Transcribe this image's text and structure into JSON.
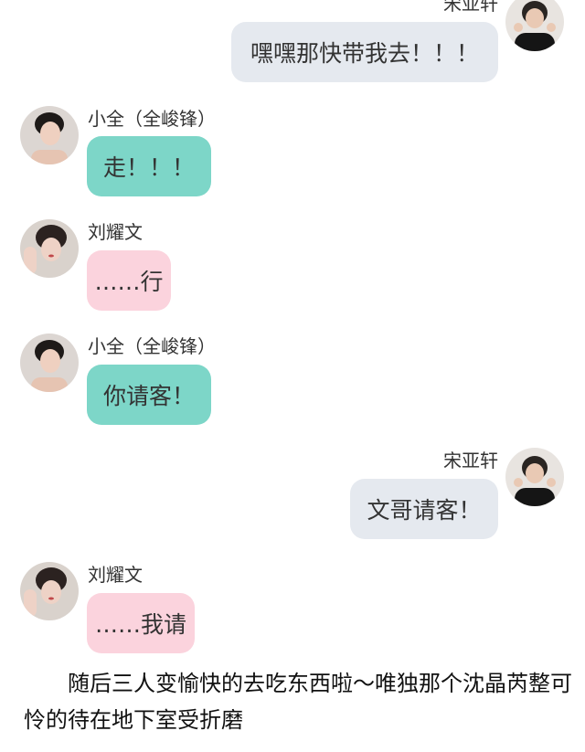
{
  "colors": {
    "bubble_self": "#e5e9ef",
    "bubble_xiaoquan": "#7dd6c8",
    "bubble_liuyaowen": "#fbd3dd"
  },
  "messages": [
    {
      "sender": "宋亚轩",
      "text": "嘿嘿那快带我去！！！",
      "side": "right"
    },
    {
      "sender": "小全（全峻锋）",
      "text": "走！！！",
      "side": "left"
    },
    {
      "sender": "刘耀文",
      "text": "……行",
      "side": "left"
    },
    {
      "sender": "小全（全峻锋）",
      "text": "你请客！",
      "side": "left"
    },
    {
      "sender": "宋亚轩",
      "text": "文哥请客！",
      "side": "right"
    },
    {
      "sender": "刘耀文",
      "text": "……我请",
      "side": "left"
    }
  ],
  "narration": "随后三人变愉快的去吃东西啦～唯独那个沈晶芮整可怜的待在地下室受折磨"
}
